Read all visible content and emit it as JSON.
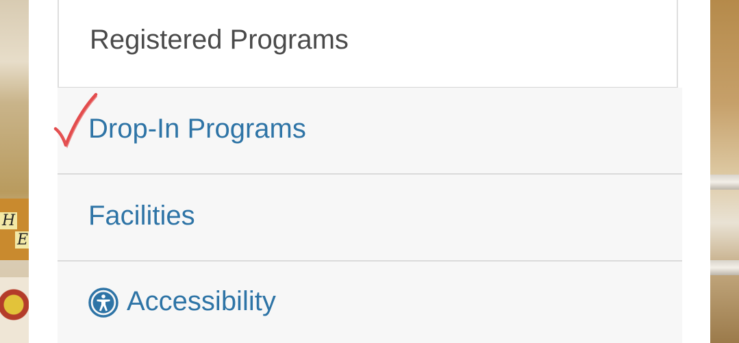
{
  "menu": {
    "items": [
      {
        "label": "Registered Programs",
        "state": "default"
      },
      {
        "label": "Drop-In Programs",
        "state": "marked"
      },
      {
        "label": "Facilities",
        "state": "default"
      },
      {
        "label": "Accessibility",
        "icon": "accessibility-icon",
        "state": "default"
      }
    ]
  },
  "annotation": {
    "mark": "checkmark",
    "color": "#e0383a"
  },
  "colors": {
    "link": "#2e74a6",
    "heading_text": "#4a4a4a",
    "item_background": "#f7f7f7",
    "panel_background": "#ffffff"
  }
}
